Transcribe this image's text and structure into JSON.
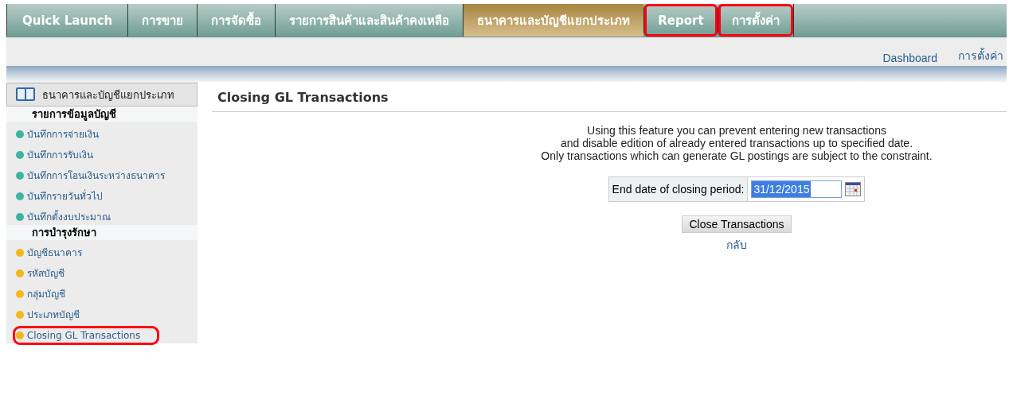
{
  "nav": [
    {
      "label": "Quick Launch",
      "selected": false,
      "highlighted": false
    },
    {
      "label": "การขาย",
      "selected": false,
      "highlighted": false
    },
    {
      "label": "การจัดซื้อ",
      "selected": false,
      "highlighted": false
    },
    {
      "label": "รายการสินค้าและสินค้าคงเหลือ",
      "selected": false,
      "highlighted": false
    },
    {
      "label": "ธนาคารและบัญชีแยกประเภท",
      "selected": true,
      "highlighted": false
    },
    {
      "label": "Report",
      "selected": false,
      "highlighted": true
    },
    {
      "label": "การตั้งค่า",
      "selected": false,
      "highlighted": true
    }
  ],
  "top_links": [
    "Dashboard",
    "การตั้งค่า"
  ],
  "sidebar": {
    "title": "ธนาคารและบัญชีแยกประเภท",
    "sections": [
      {
        "heading": "รายการข้อมูลบัญชี",
        "color": "#3bb5a0",
        "items": [
          {
            "label": "บันทึกการจ่ายเงิน",
            "highlighted": false
          },
          {
            "label": "บันทึกการรับเงิน",
            "highlighted": false
          },
          {
            "label": "บันทึกการโอนเงินระหว่างธนาคาร",
            "highlighted": false
          },
          {
            "label": "บันทึกรายวันทั่วไป",
            "highlighted": false
          },
          {
            "label": "บันทึกตั้งงบประมาณ",
            "highlighted": false
          }
        ]
      },
      {
        "heading": "การบำรุงรักษา",
        "color": "#f2b81c",
        "items": [
          {
            "label": "บัญชีธนาคาร",
            "highlighted": false
          },
          {
            "label": "รหัสบัญชี",
            "highlighted": false
          },
          {
            "label": "กลุ่มบัญชี",
            "highlighted": false
          },
          {
            "label": "ประเภทบัญชี",
            "highlighted": false
          },
          {
            "label": "Closing GL Transactions",
            "highlighted": true
          }
        ]
      }
    ]
  },
  "page": {
    "title": "Closing GL Transactions",
    "description": [
      "Using this feature you can prevent entering new transactions",
      "and disable edition of already entered transactions up to specified date.",
      "Only transactions which can generate GL postings are subject to the constraint."
    ],
    "date_label": "End date of closing period:",
    "date_value": "31/12/2015",
    "button": "Close Transactions",
    "back_link": "กลับ"
  }
}
